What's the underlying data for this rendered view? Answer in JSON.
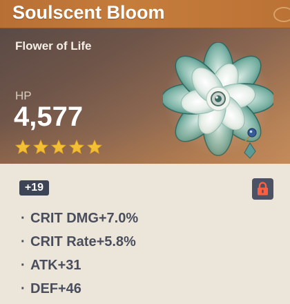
{
  "artifact": {
    "name": "Soulscent Bloom",
    "type": "Flower of Life",
    "main_stat": {
      "label": "HP",
      "value": "4,577"
    },
    "rarity_stars": 5,
    "level": "+19",
    "locked": true,
    "substats": [
      {
        "text": "CRIT DMG+7.0%"
      },
      {
        "text": "CRIT Rate+5.8%"
      },
      {
        "text": "ATK+31"
      },
      {
        "text": "DEF+46"
      }
    ]
  },
  "icons": {
    "star": "star-icon",
    "lock": "lock-icon",
    "artifact": "flower-artifact-icon"
  },
  "colors": {
    "title_bar": "#c27a3a",
    "star": "#ffcc32",
    "badge_bg": "#3d4455",
    "lock_bg": "#4a5263",
    "lock_icon": "#ff5f40",
    "substat_text": "#4a4e5c"
  }
}
